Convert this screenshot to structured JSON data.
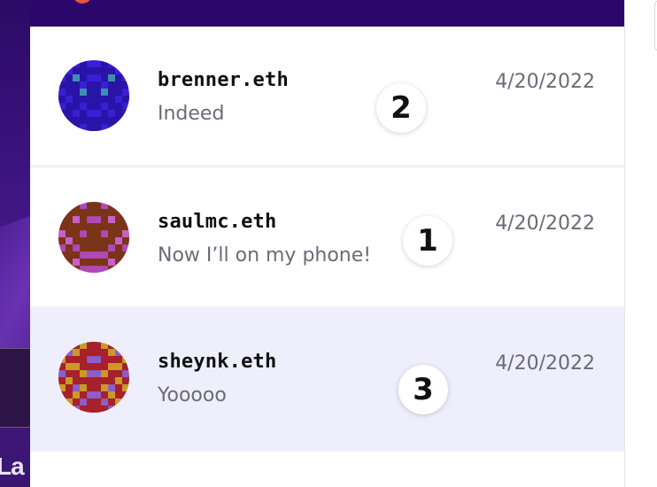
{
  "app": {
    "left_partial_text": "La"
  },
  "conversations": [
    {
      "name": "brenner.eth",
      "preview": "Indeed",
      "date": "4/20/2022",
      "badge": "2",
      "active": false,
      "avatar_colors": [
        "#3a1fd6",
        "#2a14a8",
        "#3c8fb0"
      ]
    },
    {
      "name": "saulmc.eth",
      "preview": "Now I’ll on my phone!",
      "date": "4/20/2022",
      "badge": "1",
      "active": false,
      "avatar_colors": [
        "#b048b8",
        "#7a3418",
        "#c860c8"
      ]
    },
    {
      "name": "sheynk.eth",
      "preview": "Yooooo",
      "date": "4/20/2022",
      "badge": "3",
      "active": true,
      "avatar_colors": [
        "#8a5fc8",
        "#a8202a",
        "#c89a28"
      ]
    }
  ],
  "colors": {
    "header": "#2c076b",
    "active_row": "#eeeefc",
    "muted_text": "#6b6b78"
  }
}
